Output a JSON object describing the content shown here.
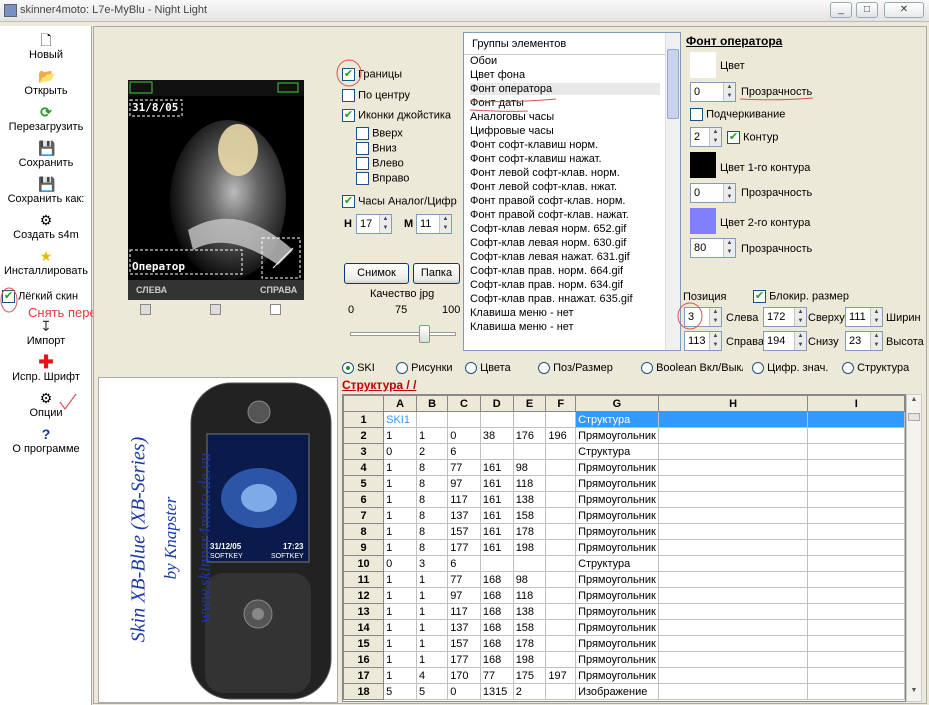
{
  "window": {
    "title": "skinner4moto: L7e-MyBlu - Night Light"
  },
  "toolbar": [
    {
      "label": "Новый",
      "icon": "new-file-icon"
    },
    {
      "label": "Открыть",
      "icon": "open-folder-icon"
    },
    {
      "label": "Перезагрузить",
      "icon": "reload-icon"
    },
    {
      "label": "Сохранить",
      "icon": "save-disk-icon"
    },
    {
      "label": "Сохранить как:",
      "icon": "save-as-disk-icon"
    },
    {
      "label": "Создать s4m",
      "icon": "create-s4m-icon"
    },
    {
      "label": "Инсталлировать",
      "icon": "install-star-icon"
    },
    {
      "label": "Импорт",
      "icon": "import-arrow-icon"
    },
    {
      "label": "Испр. Шрифт",
      "icon": "fix-font-cross-icon"
    },
    {
      "label": "Опции",
      "icon": "options-gears-icon"
    },
    {
      "label": "О программе",
      "icon": "about-question-icon"
    }
  ],
  "light_skin": {
    "label": "Лёгкий скин",
    "checked": true
  },
  "annotation_note": "Снять перед сохранением",
  "preview": {
    "date": "31/8/05",
    "operator": "Оператор",
    "soft_left": "СЛЕВА",
    "soft_right": "СПРАВА"
  },
  "options": {
    "borders": "Границы",
    "center": "По центру",
    "joystick_icons": "Иконки джойстика",
    "up": "Вверх",
    "down": "Вниз",
    "left": "Влево",
    "right": "Вправо",
    "clock": "Часы Аналог/Цифр",
    "h_label": "H",
    "h_value": "17",
    "m_label": "M",
    "m_value": "11",
    "snapshot_btn": "Снимок",
    "folder_btn": "Папка",
    "jpg_quality": "Качество jpg",
    "scale_min": "0",
    "scale_mid": "75",
    "scale_max": "100"
  },
  "groups": {
    "header": "Группы элементов",
    "items": [
      "Обои",
      "Цвет фона",
      "Фонт оператора",
      "Фонт даты",
      "Аналоговы часы",
      "Цифровые часы",
      "Фонт софт-клавиш норм.",
      "Фонт софт-клавиш нажат.",
      "Фонт левой софт-клав. норм.",
      "Фонт левой софт-клав. нжат.",
      "Фонт правой софт-клав. норм.",
      "Фонт правой софт-клав. нажат.",
      "Софт-клав левая норм. 652.gif",
      "Софт-клав левая норм. 630.gif",
      "Софт-клав левая нажат. 631.gif",
      "Софт-клав прав. норм. 664.gif",
      "Софт-клав прав. норм. 634.gif",
      "Софт-клав прав. ннажат. 635.gif",
      "Клавиша меню - нет",
      "Клавиша меню - нет"
    ],
    "selected_index": 2
  },
  "font_panel": {
    "title": "Фонт оператора",
    "color_label": "Цвет",
    "transparency_label": "Прозрачность",
    "transparency_value": "0",
    "underline_label": "Подчеркивание",
    "contour_value": "2",
    "contour_label": "Контур",
    "color1_label": "Цвет 1-го контура",
    "color1": "#000000",
    "transparency2_value": "0",
    "transparency2_label": "Прозрачность",
    "color2_label": "Цвет 2-го контура",
    "color2": "#8080ff",
    "transparency3_value": "80",
    "transparency3_label": "Прозрачность"
  },
  "position": {
    "label": "Позиция",
    "lock_size": "Блокир. размер",
    "left_value": "3",
    "left_label": "Слева",
    "top_value": "172",
    "top_label": "Сверху",
    "width_value": "111",
    "width_label": "Ширин",
    "right_value": "113",
    "right_label": "Справа",
    "bottom_value": "194",
    "bottom_label": "Снизу",
    "height_value": "23",
    "height_label": "Высота"
  },
  "radios": [
    {
      "label": "SKI",
      "on": true
    },
    {
      "label": "Рисунки",
      "on": false
    },
    {
      "label": "Цвета",
      "on": false
    },
    {
      "label": "Поз/Размер",
      "on": false
    },
    {
      "label": "Boolean Вкл/Выкл",
      "on": false
    },
    {
      "label": "Цифр. знач.",
      "on": false
    },
    {
      "label": "Структура",
      "on": false
    }
  ],
  "structure_link": "Структура / /",
  "promo": {
    "title": "Skin XB-Blue (XB-Series)",
    "author": "by Knapster",
    "url": "www.skinner4moto.de.vu",
    "phone_date": "31/12/05",
    "phone_time": "17:23",
    "softkey": "SOFTKEY"
  },
  "grid": {
    "columns": [
      "",
      "A",
      "B",
      "C",
      "D",
      "E",
      "F",
      "G",
      "H",
      "I"
    ],
    "rows": [
      [
        "1",
        "SKI1",
        "",
        "",
        "",
        "",
        "",
        "Структура",
        "",
        ""
      ],
      [
        "2",
        "1",
        "1",
        "0",
        "38",
        "176",
        "196",
        "Прямоугольник",
        "",
        ""
      ],
      [
        "3",
        "0",
        "2",
        "6",
        "",
        "",
        "",
        "Структура",
        "",
        ""
      ],
      [
        "4",
        "1",
        "8",
        "77",
        "161",
        "98",
        "",
        "Прямоугольник",
        "",
        ""
      ],
      [
        "5",
        "1",
        "8",
        "97",
        "161",
        "118",
        "",
        "Прямоугольник",
        "",
        ""
      ],
      [
        "6",
        "1",
        "8",
        "117",
        "161",
        "138",
        "",
        "Прямоугольник",
        "",
        ""
      ],
      [
        "7",
        "1",
        "8",
        "137",
        "161",
        "158",
        "",
        "Прямоугольник",
        "",
        ""
      ],
      [
        "8",
        "1",
        "8",
        "157",
        "161",
        "178",
        "",
        "Прямоугольник",
        "",
        ""
      ],
      [
        "9",
        "1",
        "8",
        "177",
        "161",
        "198",
        "",
        "Прямоугольник",
        "",
        ""
      ],
      [
        "10",
        "0",
        "3",
        "6",
        "",
        "",
        "",
        "Структура",
        "",
        ""
      ],
      [
        "11",
        "1",
        "1",
        "77",
        "168",
        "98",
        "",
        "Прямоугольник",
        "",
        ""
      ],
      [
        "12",
        "1",
        "1",
        "97",
        "168",
        "118",
        "",
        "Прямоугольник",
        "",
        ""
      ],
      [
        "13",
        "1",
        "1",
        "117",
        "168",
        "138",
        "",
        "Прямоугольник",
        "",
        ""
      ],
      [
        "14",
        "1",
        "1",
        "137",
        "168",
        "158",
        "",
        "Прямоугольник",
        "",
        ""
      ],
      [
        "15",
        "1",
        "1",
        "157",
        "168",
        "178",
        "",
        "Прямоугольник",
        "",
        ""
      ],
      [
        "16",
        "1",
        "1",
        "177",
        "168",
        "198",
        "",
        "Прямоугольник",
        "",
        ""
      ],
      [
        "17",
        "1",
        "4",
        "170",
        "77",
        "175",
        "197",
        "Прямоугольник",
        "",
        ""
      ],
      [
        "18",
        "5",
        "5",
        "0",
        "1315",
        "2",
        "",
        "Изображение",
        "",
        ""
      ]
    ]
  }
}
